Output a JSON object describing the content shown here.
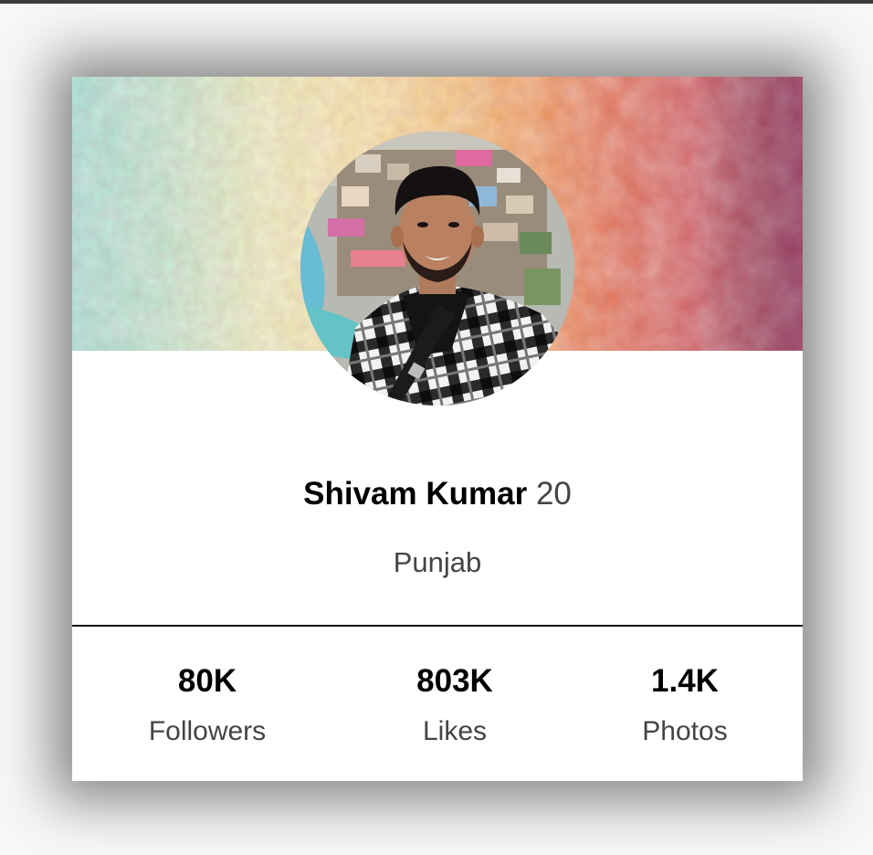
{
  "profile": {
    "name": "Shivam Kumar",
    "age": "20",
    "location": "Punjab"
  },
  "stats": [
    {
      "value": "80K",
      "label": "Followers"
    },
    {
      "value": "803K",
      "label": "Likes"
    },
    {
      "value": "1.4K",
      "label": "Photos"
    }
  ],
  "colors": {
    "cover_gradient": [
      "#9fe0d2",
      "#f6e3a0",
      "#ee9a58",
      "#cf5c5c",
      "#b44a72"
    ],
    "name_text": "#000000",
    "muted_text": "#444444",
    "divider": "#111111"
  }
}
